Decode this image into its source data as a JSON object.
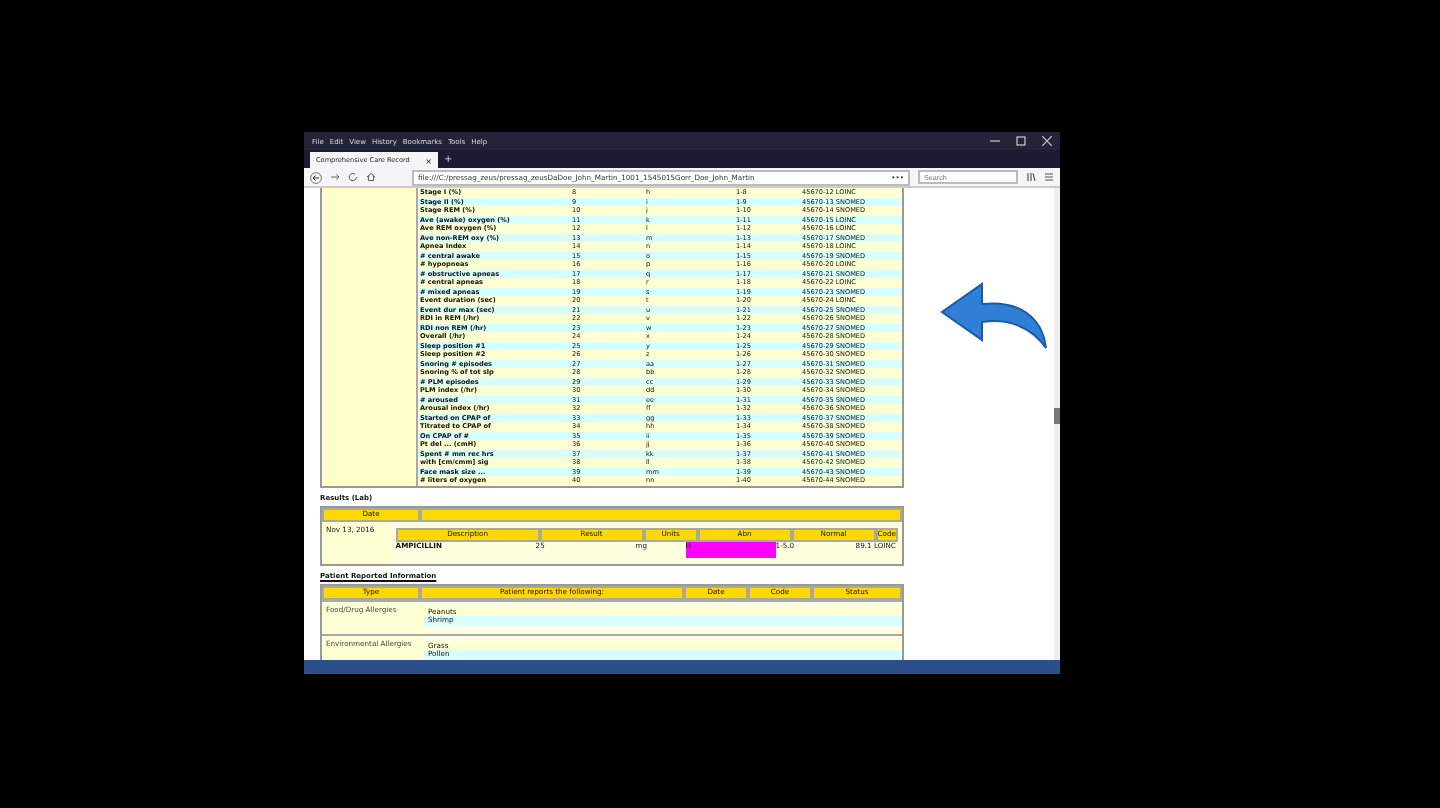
{
  "browser": {
    "menu": [
      "File",
      "Edit",
      "View",
      "History",
      "Bookmarks",
      "Tools",
      "Help"
    ],
    "tab_title": "Comprehensive Care Record",
    "tab_close": "×",
    "new_tab": "+",
    "address": "file:///C:/pressag_zeus/pressag_zeusDaDoe_John_Martin_1001_1545015Gorr_Doe_John_Martin",
    "address_more": "•••",
    "search": {
      "placeholder": "Search"
    }
  },
  "sleep_rows": [
    {
      "label": "Stage I (%)",
      "num": "8",
      "code": "h",
      "range": "1-8",
      "ref": "45670-12 LOINC"
    },
    {
      "label": "Stage II (%)",
      "num": "9",
      "code": "i",
      "range": "1-9",
      "ref": "45670-13 SNOMED"
    },
    {
      "label": "Stage REM (%)",
      "num": "10",
      "code": "j",
      "range": "1-10",
      "ref": "45670-14 SNOMED"
    },
    {
      "label": "Ave (awake) oxygen (%)",
      "num": "11",
      "code": "k",
      "range": "1-11",
      "ref": "45670-15 LOINC"
    },
    {
      "label": "Ave REM oxygen (%)",
      "num": "12",
      "code": "l",
      "range": "1-12",
      "ref": "45670-16 LOINC"
    },
    {
      "label": "Ave non-REM oxy (%)",
      "num": "13",
      "code": "m",
      "range": "1-13",
      "ref": "45670-17 SNOMED"
    },
    {
      "label": "Apnea Index",
      "num": "14",
      "code": "n",
      "range": "1-14",
      "ref": "45670-18 LOINC"
    },
    {
      "label": "# central awake",
      "num": "15",
      "code": "o",
      "range": "1-15",
      "ref": "45670-19 SNOMED"
    },
    {
      "label": "# hypopneas",
      "num": "16",
      "code": "p",
      "range": "1-16",
      "ref": "45670-20 LOINC"
    },
    {
      "label": "# obstructive apneas",
      "num": "17",
      "code": "q",
      "range": "1-17",
      "ref": "45670-21 SNOMED"
    },
    {
      "label": "# central apneas",
      "num": "18",
      "code": "r",
      "range": "1-18",
      "ref": "45670-22 LOINC"
    },
    {
      "label": "# mixed apneas",
      "num": "19",
      "code": "s",
      "range": "1-19",
      "ref": "45670-23 SNOMED"
    },
    {
      "label": "Event duration (sec)",
      "num": "20",
      "code": "t",
      "range": "1-20",
      "ref": "45670-24 LOINC"
    },
    {
      "label": "Event dur max (sec)",
      "num": "21",
      "code": "u",
      "range": "1-21",
      "ref": "45670-25 SNOMED"
    },
    {
      "label": "RDI in REM (/hr)",
      "num": "22",
      "code": "v",
      "range": "1-22",
      "ref": "45670-26 SNOMED"
    },
    {
      "label": "RDI non REM (/hr)",
      "num": "23",
      "code": "w",
      "range": "1-23",
      "ref": "45670-27 SNOMED"
    },
    {
      "label": "Overall (/hr)",
      "num": "24",
      "code": "x",
      "range": "1-24",
      "ref": "45670-28 SNOMED"
    },
    {
      "label": "Sleep position #1",
      "num": "25",
      "code": "y",
      "range": "1-25",
      "ref": "45670-29 SNOMED"
    },
    {
      "label": "Sleep position #2",
      "num": "26",
      "code": "z",
      "range": "1-26",
      "ref": "45670-30 SNOMED"
    },
    {
      "label": "Snoring # episodes",
      "num": "27",
      "code": "aa",
      "range": "1-27",
      "ref": "45670-31 SNOMED"
    },
    {
      "label": "Snoring % of tot slp",
      "num": "28",
      "code": "bb",
      "range": "1-28",
      "ref": "45670-32 SNOMED"
    },
    {
      "label": "# PLM episodes",
      "num": "29",
      "code": "cc",
      "range": "1-29",
      "ref": "45670-33 SNOMED"
    },
    {
      "label": "PLM index (/hr)",
      "num": "30",
      "code": "dd",
      "range": "1-30",
      "ref": "45670-34 SNOMED"
    },
    {
      "label": "# aroused",
      "num": "31",
      "code": "ee",
      "range": "1-31",
      "ref": "45670-35 SNOMED"
    },
    {
      "label": "Arousal index (/hr)",
      "num": "32",
      "code": "ff",
      "range": "1-32",
      "ref": "45670-36 SNOMED"
    },
    {
      "label": "Started on CPAP of",
      "num": "33",
      "code": "gg",
      "range": "1-33",
      "ref": "45670-37 SNOMED"
    },
    {
      "label": "Titrated to CPAP of",
      "num": "34",
      "code": "hh",
      "range": "1-34",
      "ref": "45670-38 SNOMED"
    },
    {
      "label": "On CPAP of #",
      "num": "35",
      "code": "ii",
      "range": "1-35",
      "ref": "45670-39 SNOMED"
    },
    {
      "label": "Pt del ... (cmH)",
      "num": "36",
      "code": "jj",
      "range": "1-36",
      "ref": "45670-40 SNOMED"
    },
    {
      "label": "Spent # mm rec hrs",
      "num": "37",
      "code": "kk",
      "range": "1-37",
      "ref": "45670-41 SNOMED"
    },
    {
      "label": "with [cm/cmm] sig",
      "num": "38",
      "code": "ll",
      "range": "1-38",
      "ref": "45670-42 SNOMED"
    },
    {
      "label": "Face mask size ...",
      "num": "39",
      "code": "mm",
      "range": "1-39",
      "ref": "45670-43 SNOMED"
    },
    {
      "label": "# liters of oxygen",
      "num": "40",
      "code": "nn",
      "range": "1-40",
      "ref": "45670-44 SNOMED"
    }
  ],
  "results": {
    "title": "Results (Lab)",
    "columns": [
      "Date",
      ""
    ],
    "date": "Nov 13, 2016",
    "inner_columns": [
      "Description",
      "Result",
      "Units",
      "Abn",
      "Normal",
      "Code"
    ],
    "rows": [
      {
        "description": "AMPICILLIN",
        "result": "25",
        "units": "mg",
        "abn": "H",
        "abnormal": true,
        "normal": "1-5.0",
        "code": "89.1 LOINC"
      }
    ]
  },
  "patient_reported": {
    "title": "Patient Reported Information",
    "columns": [
      "Type",
      "Patient reports the following:",
      "Date",
      "Code",
      "Status"
    ],
    "groups": [
      {
        "type": "Food/Drug Allergies",
        "items": [
          "Peanuts",
          "Shrimp"
        ]
      },
      {
        "type": "Environmental Allergies",
        "items": [
          "Grass",
          "Pollen"
        ]
      }
    ]
  }
}
